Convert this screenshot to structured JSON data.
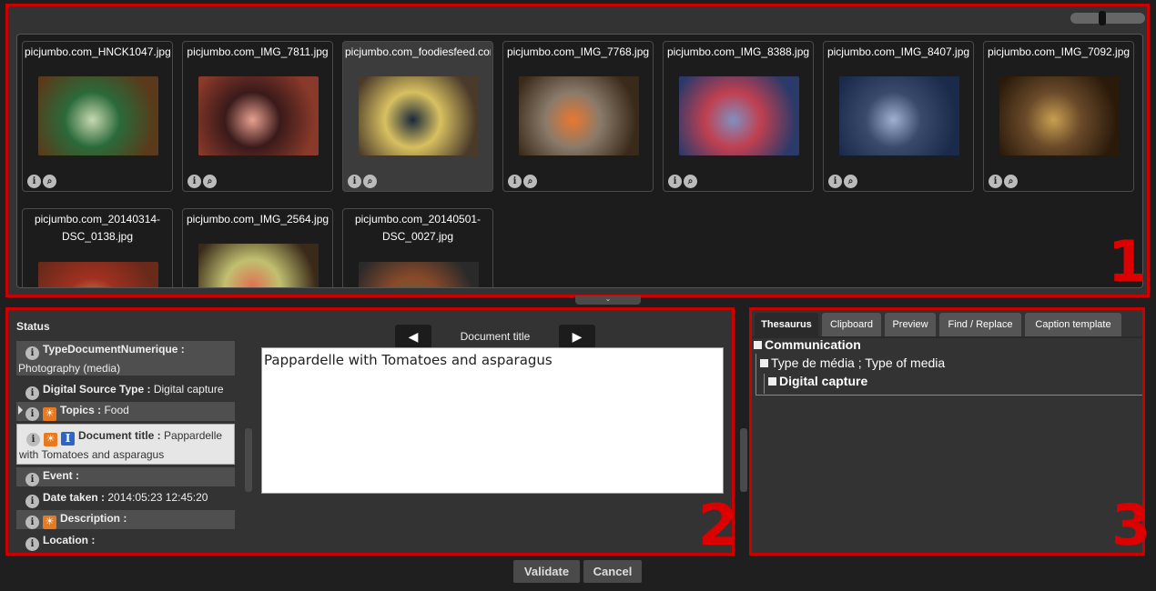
{
  "browser": {
    "zoom_slider_level": 0.42,
    "images": [
      {
        "filename": "picjumbo.com_HNCK1047.jpg",
        "colors": [
          "#5a3a1a",
          "#c8d8b0",
          "#2a6a3a"
        ]
      },
      {
        "filename": "picjumbo.com_IMG_7811.jpg",
        "colors": [
          "#8a3a2a",
          "#e8a090",
          "#3a1a1a"
        ]
      },
      {
        "filename": "picjumbo.com_foodiesfeed.com",
        "colors": [
          "#4a3a2a",
          "#1a2a3a",
          "#d8c060"
        ]
      },
      {
        "filename": "picjumbo.com_IMG_7768.jpg",
        "colors": [
          "#3a2a1a",
          "#e87830",
          "#8a7a6a"
        ]
      },
      {
        "filename": "picjumbo.com_IMG_8388.jpg",
        "colors": [
          "#2a3a6a",
          "#8090c0",
          "#c04050"
        ]
      },
      {
        "filename": "picjumbo.com_IMG_8407.jpg",
        "colors": [
          "#1a2a4a",
          "#a0b0d0",
          "#3a4a6a"
        ]
      },
      {
        "filename": "picjumbo.com_IMG_7092.jpg",
        "colors": [
          "#2a1a0a",
          "#c8a050",
          "#6a4a2a"
        ]
      },
      {
        "filename": "picjumbo.com_20140314-DSC_0138.jpg",
        "colors": [
          "#6a2a1a",
          "#d89060",
          "#a03020"
        ]
      },
      {
        "filename": "picjumbo.com_IMG_2564.jpg",
        "colors": [
          "#3a2a1a",
          "#e07050",
          "#c0c070"
        ]
      },
      {
        "filename": "picjumbo.com_20140501-DSC_0027.jpg",
        "colors": [
          "#2a2a2a",
          "#5a6a3a",
          "#8a4a2a"
        ]
      }
    ],
    "selected_index": 2,
    "region_number": "1"
  },
  "metadata": {
    "status_label": "Status",
    "rows": [
      {
        "label": "TypeDocumentNumerique :",
        "value": "Photography (media)"
      },
      {
        "label": "Digital Source Type :",
        "value": "Digital capture"
      },
      {
        "label": "Topics :",
        "value": "Food"
      },
      {
        "label": "Document title :",
        "value": "Pappardelle with Tomatoes and asparagus"
      },
      {
        "label": "Event :",
        "value": ""
      },
      {
        "label": "Date taken :",
        "value": "2014:05:23 12:45:20"
      },
      {
        "label": "Description :",
        "value": ""
      },
      {
        "label": "Location :",
        "value": ""
      }
    ],
    "field_title": "Document title",
    "editor_value": "Pappardelle with Tomatoes and asparagus",
    "prev_glyph": "◀",
    "next_glyph": "▶",
    "region_number": "2"
  },
  "thesaurus": {
    "tabs": [
      "Thesaurus",
      "Clipboard",
      "Preview",
      "Find / Replace",
      "Caption template"
    ],
    "active_tab": 0,
    "tree": [
      {
        "label": "Communication"
      },
      {
        "label": "Type de média ; Type of media"
      },
      {
        "label": "Digital capture"
      }
    ],
    "region_number": "3"
  },
  "actions": {
    "validate": "Validate",
    "cancel": "Cancel"
  }
}
